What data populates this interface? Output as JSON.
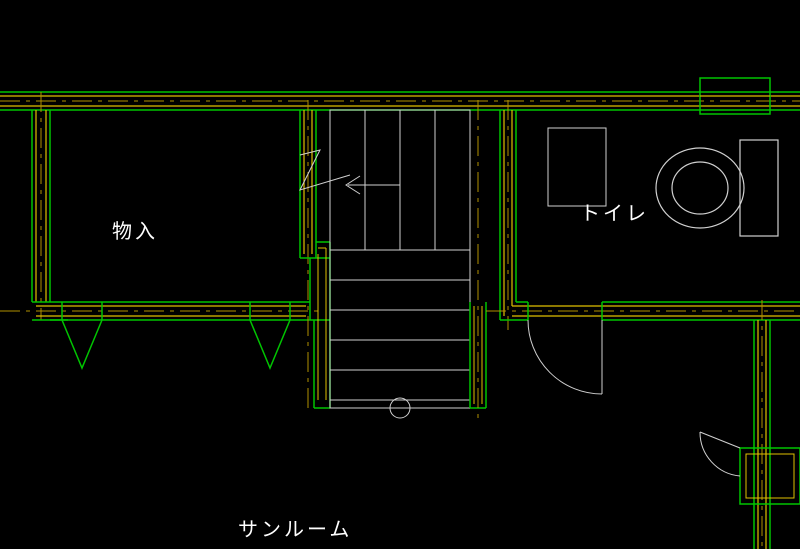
{
  "rooms": {
    "storage": {
      "label": "物入"
    },
    "toilet": {
      "label": "トイレ"
    },
    "sunroom": {
      "label": "サンルーム"
    }
  },
  "colors": {
    "bg": "#000000",
    "wall_outer": "#00c400",
    "wall_inner": "#e0c000",
    "line_white": "#e0e0e0",
    "dash": "#806000"
  }
}
